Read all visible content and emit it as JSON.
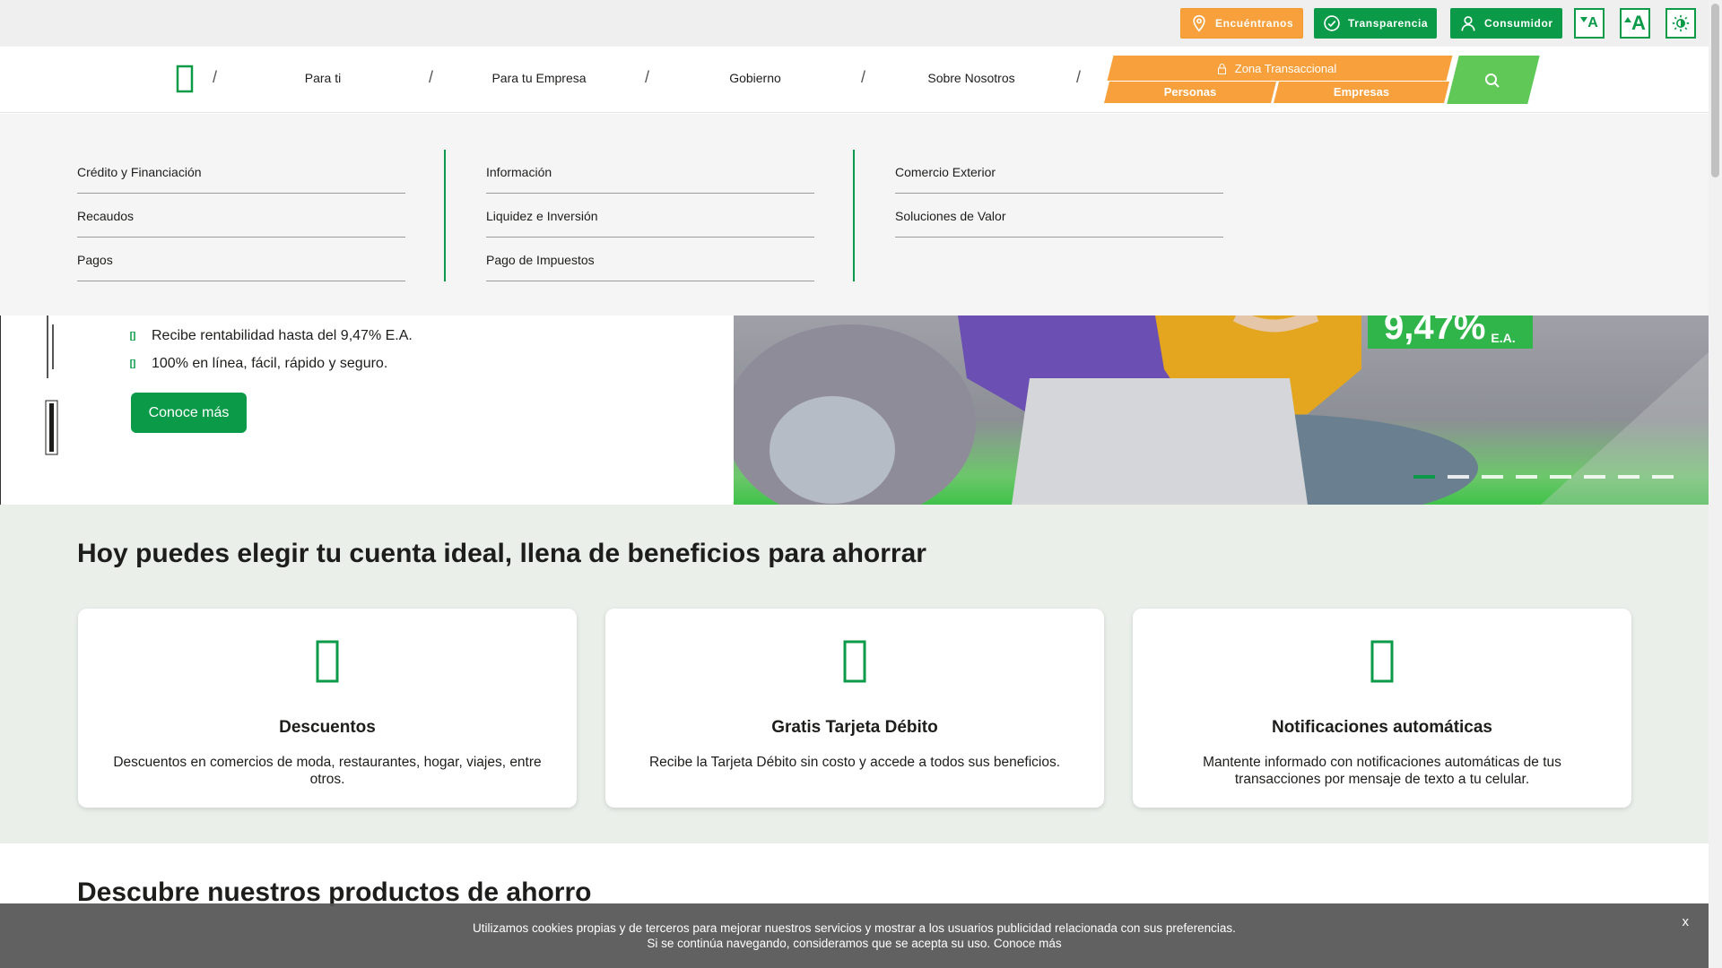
{
  "topbar": {
    "locate_label": "Encuéntranos",
    "locate_icon": "location-pin-icon",
    "transparency_label": "Transparencia",
    "transparency_icon": "check-circle-icon",
    "consumer_label": "Consumidor",
    "consumer_icon": "user-icon",
    "font_decrease_label": "A",
    "font_increase_label": "A",
    "contrast_icon": "contrast-icon"
  },
  "nav": {
    "home_icon": "home-icon",
    "items": [
      {
        "label": "Para ti"
      },
      {
        "label": "Para tu Empresa"
      },
      {
        "label": "Gobierno"
      },
      {
        "label": "Sobre Nosotros"
      }
    ],
    "separator": "/",
    "zone_label": "Zona Transaccional",
    "zone_persons": "Personas",
    "zone_companies": "Empresas",
    "search_icon": "search-icon"
  },
  "megamenu": {
    "columns": [
      {
        "items": [
          "Crédito y Financiación",
          "Recaudos",
          "Pagos"
        ]
      },
      {
        "items": [
          "Información",
          "Liquidez e Inversión",
          "Pago de Impuestos"
        ]
      },
      {
        "items": [
          "Comercio Exterior",
          "Soluciones de Valor"
        ]
      }
    ]
  },
  "hero": {
    "bullets": [
      "Recibe rentabilidad hasta del 9,47% E.A.",
      "100% en línea, fácil, rápido y seguro."
    ],
    "cta_label": "Conoce más",
    "rate_value": "9,47%",
    "rate_unit": "E.A.",
    "slide_count": 8,
    "active_slide": 1
  },
  "benefits": {
    "title": "Hoy puedes elegir tu cuenta ideal, llena de beneficios para ahorrar",
    "cards": [
      {
        "icon": "tag-icon",
        "title": "Descuentos",
        "desc": "Descuentos en comercios de moda, restaurantes, hogar, viajes, entre otros."
      },
      {
        "icon": "card-icon",
        "title": "Gratis Tarjeta Débito",
        "desc": "Recibe la Tarjeta Débito sin costo y accede a todos sus beneficios."
      },
      {
        "icon": "phone-icon",
        "title": "Notificaciones automáticas",
        "desc": "Mantente informado con notificaciones automáticas de tus transacciones por mensaje de texto a tu celular."
      }
    ]
  },
  "products": {
    "title": "Descubre nuestros productos de ahorro"
  },
  "cookie": {
    "line1": "Utilizamos cookies propias y de terceros para mejorar nuestros servicios y mostrar a los usuarios publicidad relacionada con sus preferencias.",
    "line2_prefix": "Si se continúa navegando, consideramos que se acepta su uso.",
    "link_label": "Conoce más",
    "close_label": "x"
  },
  "colors": {
    "brand_green": "#0b9b48",
    "accent_orange": "#f7a03c",
    "light_green": "#5fc856"
  }
}
